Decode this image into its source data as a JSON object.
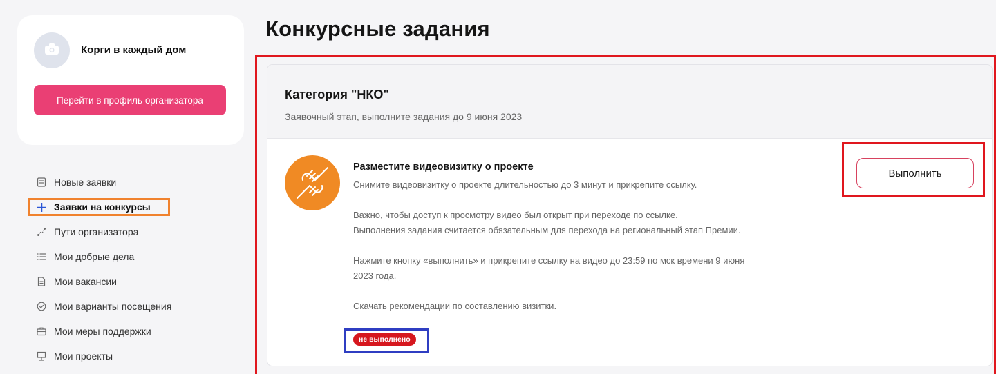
{
  "sidebar": {
    "org_name": "Корги в каждый дом",
    "profile_button": "Перейти в профиль организатора",
    "nav": [
      {
        "label": "Новые заявки",
        "icon": "document-list-icon"
      },
      {
        "label": "Заявки на конкурсы",
        "icon": "plus-icon",
        "active": true
      },
      {
        "label": "Пути организатора",
        "icon": "route-icon"
      },
      {
        "label": "Мои добрые дела",
        "icon": "list-icon"
      },
      {
        "label": "Мои вакансии",
        "icon": "document-icon"
      },
      {
        "label": "Мои варианты посещения",
        "icon": "check-circle-icon"
      },
      {
        "label": "Мои меры поддержки",
        "icon": "briefcase-icon"
      },
      {
        "label": "Мои проекты",
        "icon": "presentation-icon"
      }
    ]
  },
  "main": {
    "title": "Конкурсные задания",
    "category": {
      "title": "Категория \"НКО\"",
      "subtitle": "Заявочный этап, выполните задания до 9 июня 2023"
    },
    "task": {
      "icon": "handshake-icon",
      "title": "Разместите видеовизитку о проекте",
      "line1": "Снимите видеовизитку о проекте длительностью до 3 минут и прикрепите ссылку.",
      "line2": "Важно, чтобы доступ к просмотру видео был открыт при переходе по ссылке.",
      "line3": "Выполнения задания считается обязательным для перехода на региональный этап Премии.",
      "line4": "Нажмите кнопку «выполнить» и прикрепите ссылку на видео до 23:59 по мск времени 9 июня",
      "line5": "2023 года.",
      "line6": "Скачать рекомендации по составлению визитки.",
      "status": "не выполнено",
      "button": "Выполнить"
    }
  },
  "colors": {
    "accent_pink": "#ea3f74",
    "status_red": "#d6171e",
    "task_icon_orange": "#f08a24",
    "highlight_red": "#e0171e",
    "highlight_orange": "#f0822e",
    "highlight_blue": "#2f3ec2"
  }
}
